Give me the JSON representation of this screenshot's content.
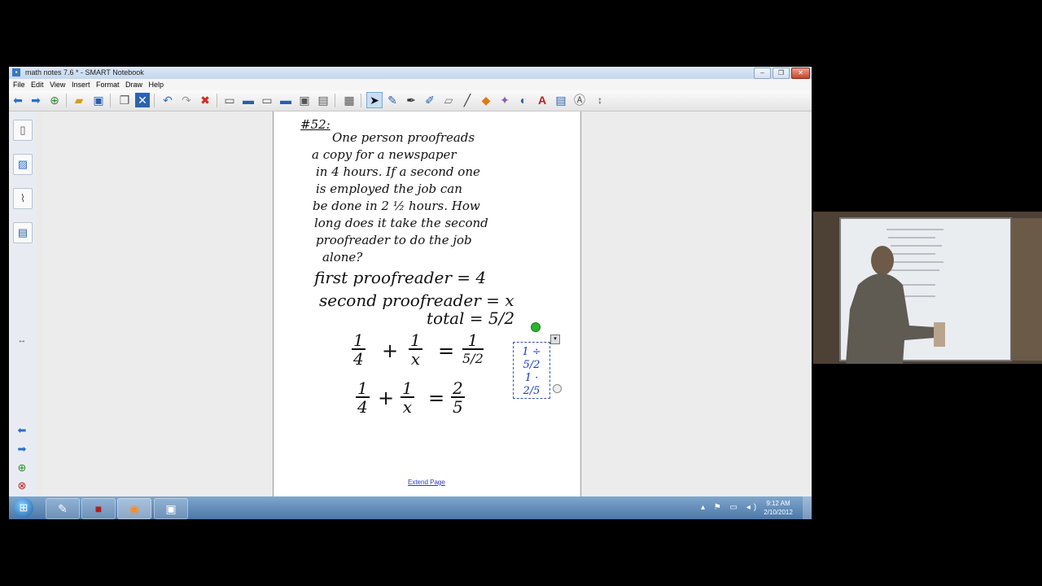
{
  "window": {
    "title": "math notes 7.6 * - SMART Notebook",
    "controls": [
      "–",
      "❐",
      "✕"
    ]
  },
  "menu": [
    "File",
    "Edit",
    "View",
    "Insert",
    "Format",
    "Draw",
    "Help"
  ],
  "notebook": {
    "problem_number": "#52:",
    "problem_lines": [
      "One person proofreads",
      "a copy for a newspaper",
      "in 4 hours. If a second one",
      "is employed the job can",
      "be done in 2 ½ hours. How",
      "long does it take the second",
      "proofreader to do the job",
      "alone?"
    ],
    "given": {
      "first": "first proofreader = 4",
      "second": "second proofreader = x",
      "total": "total = 5/2"
    },
    "eq1": {
      "t1_num": "1",
      "t1_den": "4",
      "t2_num": "1",
      "t2_den": "x",
      "r_num": "1",
      "r_den": "5/2"
    },
    "eq2": {
      "t1_num": "1",
      "t1_den": "4",
      "t2_num": "1",
      "t2_den": "x",
      "r_num": "2",
      "r_den": "5"
    },
    "selected_ink": {
      "line1": "1 ÷ 5/2",
      "line2": "1 · 2/5"
    },
    "extend_page": "Extend Page"
  },
  "taskbar": {
    "time": "9:12 AM",
    "date": "2/10/2012"
  },
  "colors": {
    "accent": "#3a76c4",
    "ink_blue": "#1836c2",
    "selection_handle": "#2db52d"
  }
}
